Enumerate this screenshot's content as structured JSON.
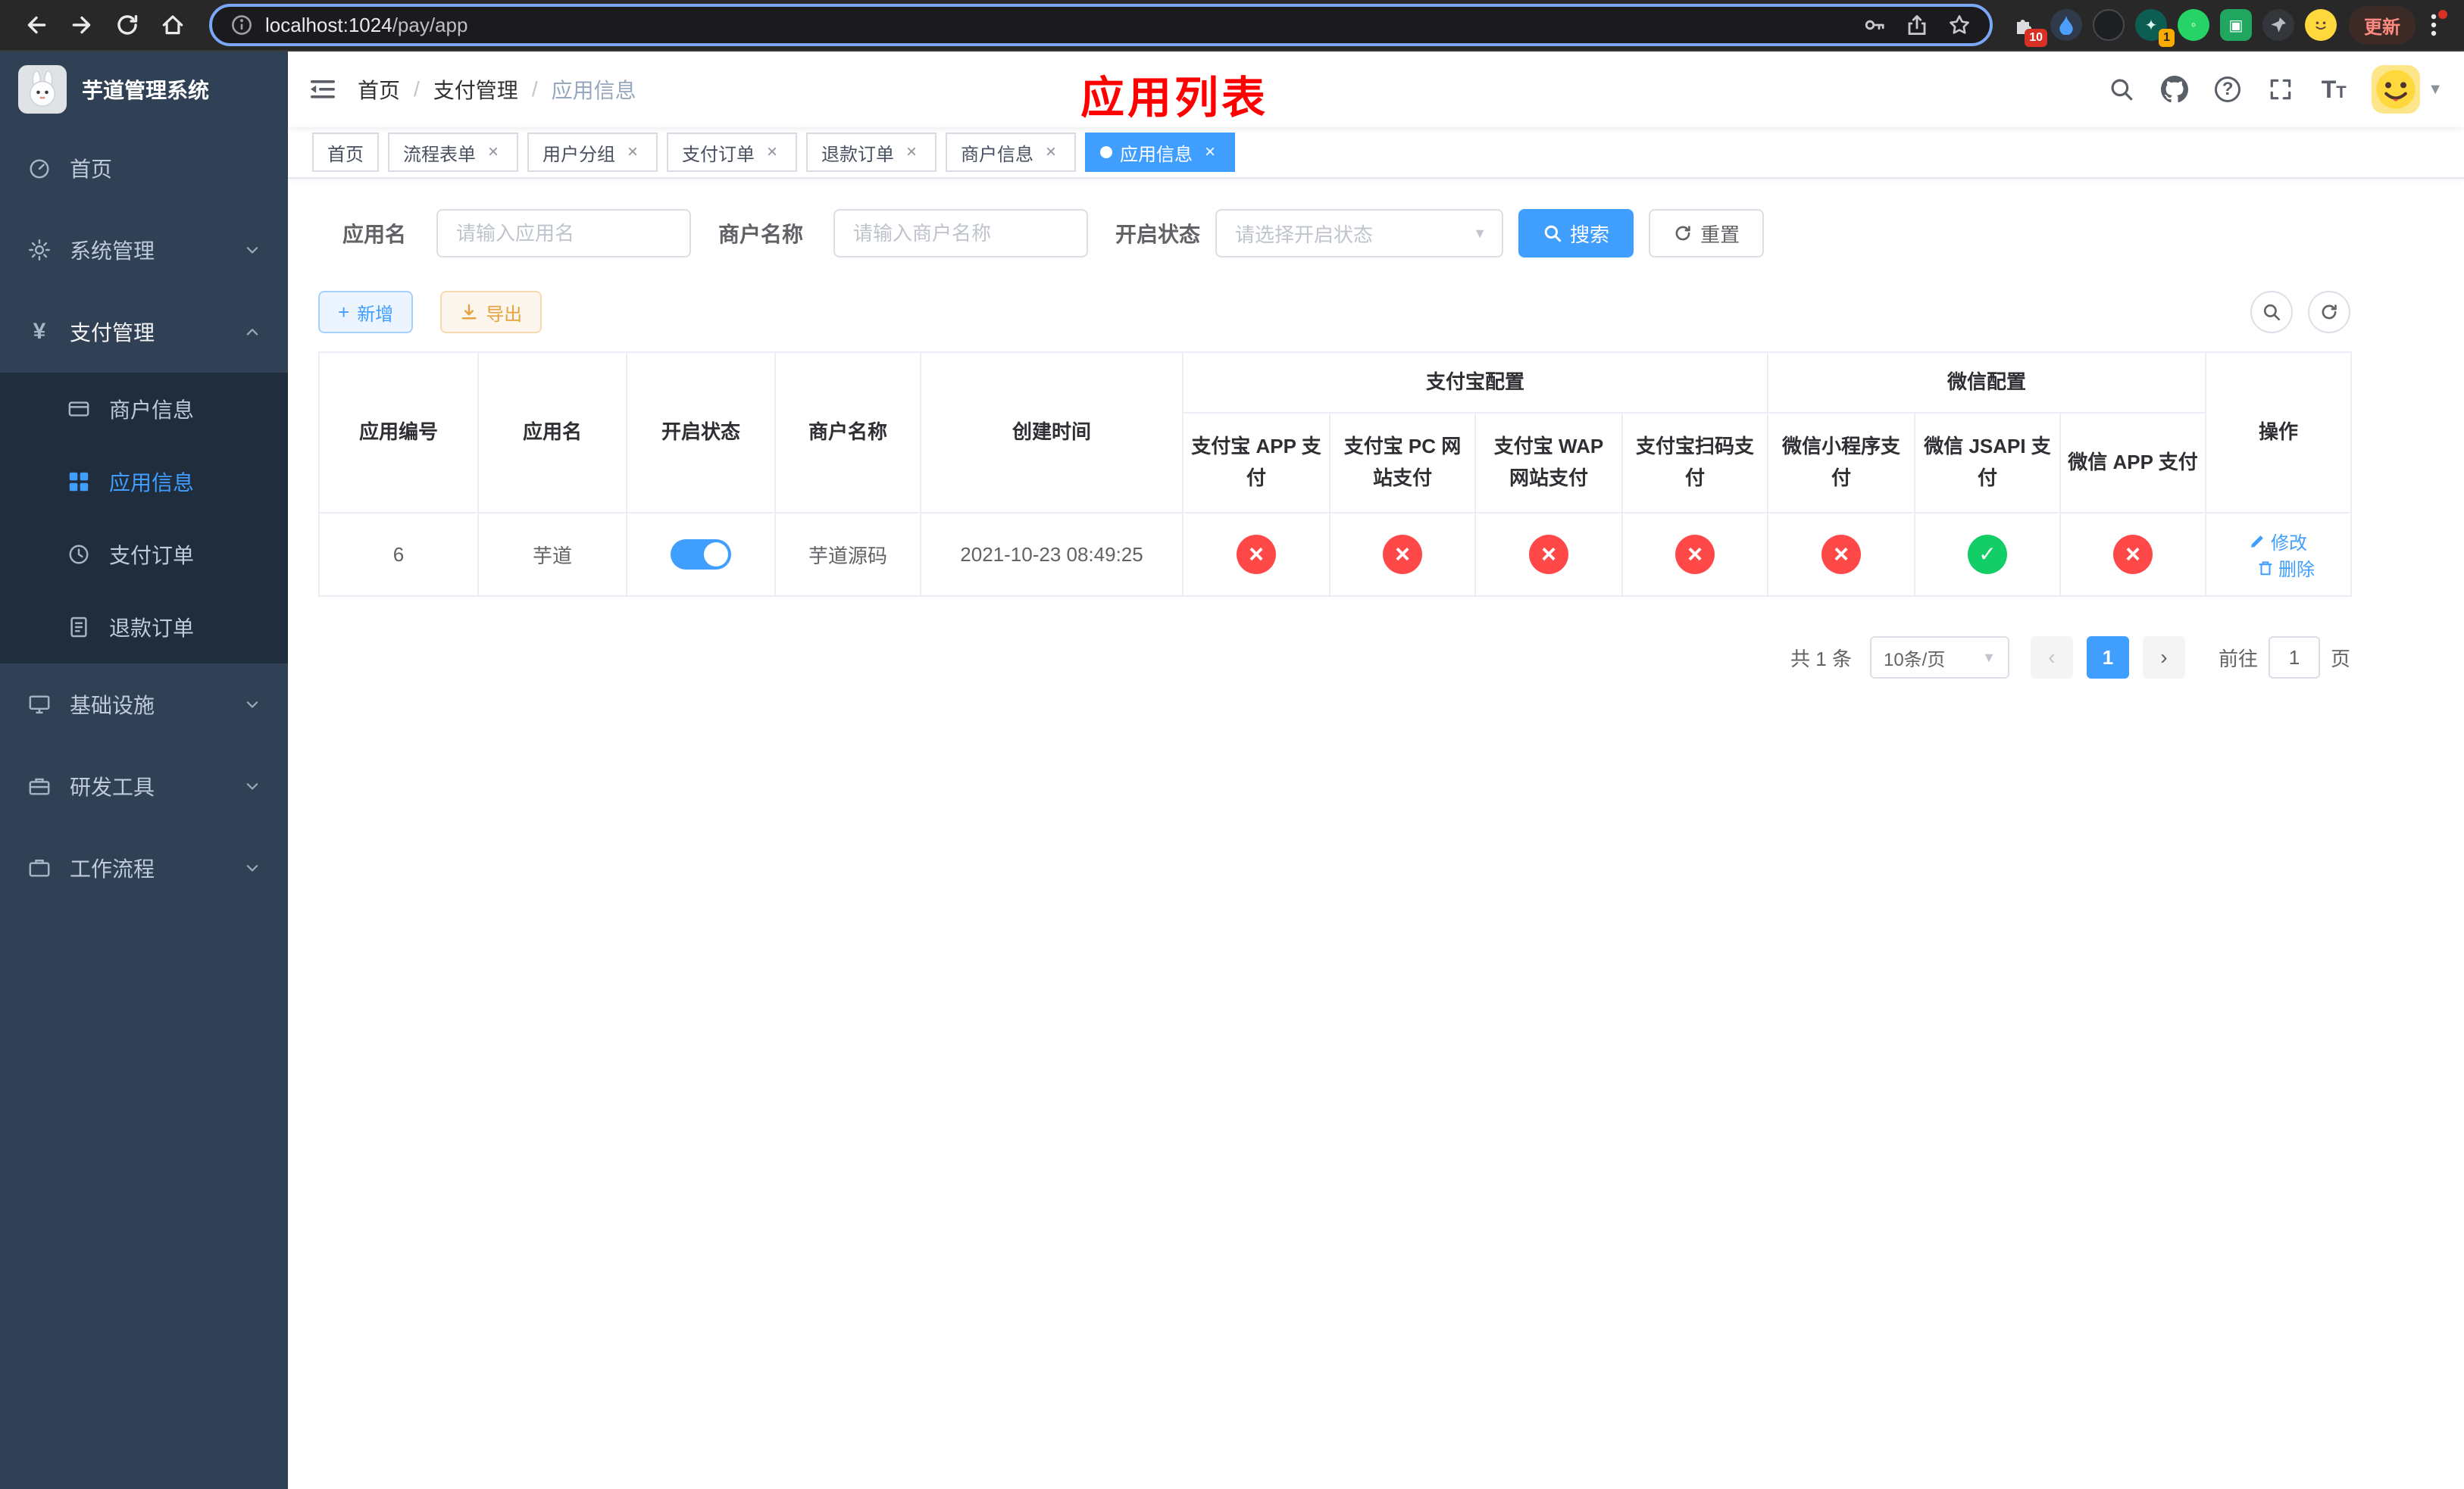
{
  "browser": {
    "url_host": "localhost:1024",
    "url_path": "/pay/app",
    "update_label": "更新",
    "extensions_badge": "10",
    "extension_badge_2": "1"
  },
  "sidebar": {
    "title": "芋道管理系统",
    "items": {
      "home": "首页",
      "system": "系统管理",
      "payment": "支付管理",
      "merchant_info": "商户信息",
      "app_info": "应用信息",
      "pay_order": "支付订单",
      "refund_order": "退款订单",
      "infrastructure": "基础设施",
      "dev_tools": "研发工具",
      "workflow": "工作流程"
    }
  },
  "header": {
    "breadcrumb": [
      "首页",
      "支付管理",
      "应用信息"
    ],
    "page_title": "应用列表"
  },
  "tabs": [
    {
      "label": "首页"
    },
    {
      "label": "流程表单"
    },
    {
      "label": "用户分组"
    },
    {
      "label": "支付订单"
    },
    {
      "label": "退款订单"
    },
    {
      "label": "商户信息"
    },
    {
      "label": "应用信息"
    }
  ],
  "filters": {
    "app_name_label": "应用名",
    "app_name_placeholder": "请输入应用名",
    "merchant_label": "商户名称",
    "merchant_placeholder": "请输入商户名称",
    "status_label": "开启状态",
    "status_placeholder": "请选择开启状态",
    "search_label": "搜索",
    "reset_label": "重置"
  },
  "toolbar": {
    "add_label": "新增",
    "export_label": "导出"
  },
  "table": {
    "groups": {
      "alipay": "支付宝配置",
      "wechat": "微信配置"
    },
    "columns": [
      "应用编号",
      "应用名",
      "开启状态",
      "商户名称",
      "创建时间",
      "支付宝 APP 支付",
      "支付宝 PC 网站支付",
      "支付宝 WAP 网站支付",
      "支付宝扫码支付",
      "微信小程序支付",
      "微信 JSAPI 支付",
      "微信 APP 支付",
      "操作"
    ],
    "rows": [
      {
        "app_id": "6",
        "app_name": "芋道",
        "enabled": true,
        "merchant_name": "芋道源码",
        "create_time": "2021-10-23 08:49:25",
        "alipay_app": false,
        "alipay_pc": false,
        "alipay_wap": false,
        "alipay_qr": false,
        "wechat_mini": false,
        "wechat_jsapi": true,
        "wechat_app": false,
        "edit_label": "修改",
        "delete_label": "删除"
      }
    ]
  },
  "pagination": {
    "total": "共 1 条",
    "page_size": "10条/页",
    "prev_icon": "‹",
    "next_icon": "›",
    "current_page": "1",
    "goto_label": "前往",
    "goto_value": "1",
    "page_unit": "页"
  }
}
